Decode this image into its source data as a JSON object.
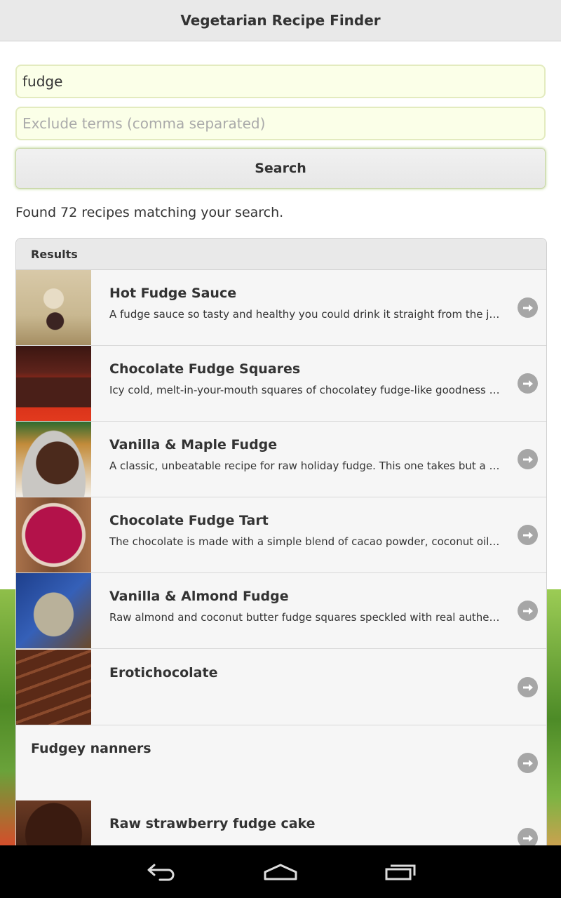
{
  "app": {
    "title": "Vegetarian Recipe Finder"
  },
  "search": {
    "query_value": "fudge",
    "exclude_value": "",
    "exclude_placeholder": "Exclude terms (comma separated)",
    "button_label": "Search"
  },
  "status": {
    "found_text": "Found 72 recipes matching your search."
  },
  "results": {
    "header": "Results",
    "items": [
      {
        "title": "Hot Fudge Sauce",
        "description": "A fudge sauce so tasty and healthy you could drink it straight from the jar. Thi…"
      },
      {
        "title": "Chocolate Fudge Squares",
        "description": "Icy cold, melt-in-your-mouth squares of chocolatey fudge-like goodness that r…"
      },
      {
        "title": "Vanilla & Maple Fudge",
        "description": "A classic, unbeatable recipe for raw holiday fudge. This one takes but a few si…"
      },
      {
        "title": "Chocolate Fudge Tart",
        "description": "The chocolate is made with a simple blend of cacao powder, coconut oil and …"
      },
      {
        "title": "Vanilla & Almond Fudge",
        "description": "Raw almond and coconut butter fudge squares speckled with real authentic v…"
      },
      {
        "title": "Erotichocolate",
        "description": ""
      },
      {
        "title": "Fudgey nanners",
        "description": ""
      },
      {
        "title": "Raw strawberry fudge cake",
        "description": ""
      }
    ]
  },
  "icons": {
    "row_arrow": "arrow-right-circle-icon",
    "nav_back": "back-icon",
    "nav_home": "home-icon",
    "nav_recents": "recents-icon"
  },
  "colors": {
    "input_bg": "#fbffe8",
    "header_bg": "#e9e9e9",
    "list_bg": "#f6f6f6",
    "arrow": "#a6a6a6",
    "navbar": "#000000"
  }
}
